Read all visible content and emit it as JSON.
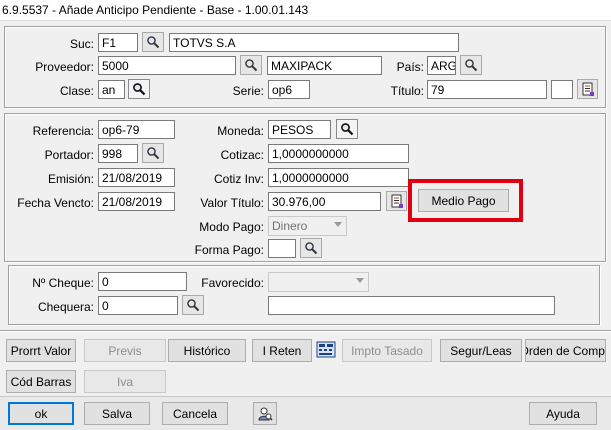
{
  "window": {
    "title": "6.9.5537 - Añade Anticipo Pendiente - Base - 1.00.01.143"
  },
  "header": {
    "suc_label": "Suc:",
    "suc_value": "F1",
    "suc_desc": "TOTVS S.A",
    "proveedor_label": "Proveedor:",
    "proveedor_value": "5000",
    "proveedor_desc": "MAXIPACK",
    "pais_label": "País:",
    "pais_value": "ARG",
    "clase_label": "Clase:",
    "clase_value": "an",
    "serie_label": "Serie:",
    "serie_value": "op6",
    "titulo_label": "Título:",
    "titulo_value": "79"
  },
  "detail": {
    "referencia_label": "Referencia:",
    "referencia_value": "op6-79",
    "portador_label": "Portador:",
    "portador_value": "998",
    "emision_label": "Emisión:",
    "emision_value": "21/08/2019",
    "fecha_vencto_label": "Fecha Vencto:",
    "fecha_vencto_value": "21/08/2019",
    "moneda_label": "Moneda:",
    "moneda_value": "PESOS",
    "cotizac_label": "Cotizac:",
    "cotizac_value": "1,0000000000",
    "cotiz_inv_label": "Cotiz Inv:",
    "cotiz_inv_value": "1,0000000000",
    "valor_titulo_label": "Valor Título:",
    "valor_titulo_value": "30.976,00",
    "modo_pago_label": "Modo Pago:",
    "modo_pago_value": "Dinero",
    "forma_pago_label": "Forma Pago:",
    "forma_pago_value": "",
    "medio_pago_button": "Medio Pago",
    "highlight_color": "#e0000f"
  },
  "cheque": {
    "numero_label": "Nº Cheque:",
    "numero_value": "0",
    "favorecido_label": "Favorecido:",
    "favorecido_value": "",
    "chequera_label": "Chequera:",
    "chequera_value": "0",
    "chequera_desc": ""
  },
  "actions_row1": {
    "prorrt_valor": "Prorrt Valor",
    "previs": "Previs",
    "historico": "Histórico",
    "i_reten": "I Reten",
    "impto_tasado": "Impto Tasado",
    "segur_leas": "Segur/Leas",
    "orden_de_compra": "Orden de Compr."
  },
  "actions_row2": {
    "cod_barras": "Cód Barras",
    "iva": "Iva"
  },
  "footer": {
    "ok": "ok",
    "salva": "Salva",
    "cancela": "Cancela",
    "ayuda": "Ayuda"
  }
}
